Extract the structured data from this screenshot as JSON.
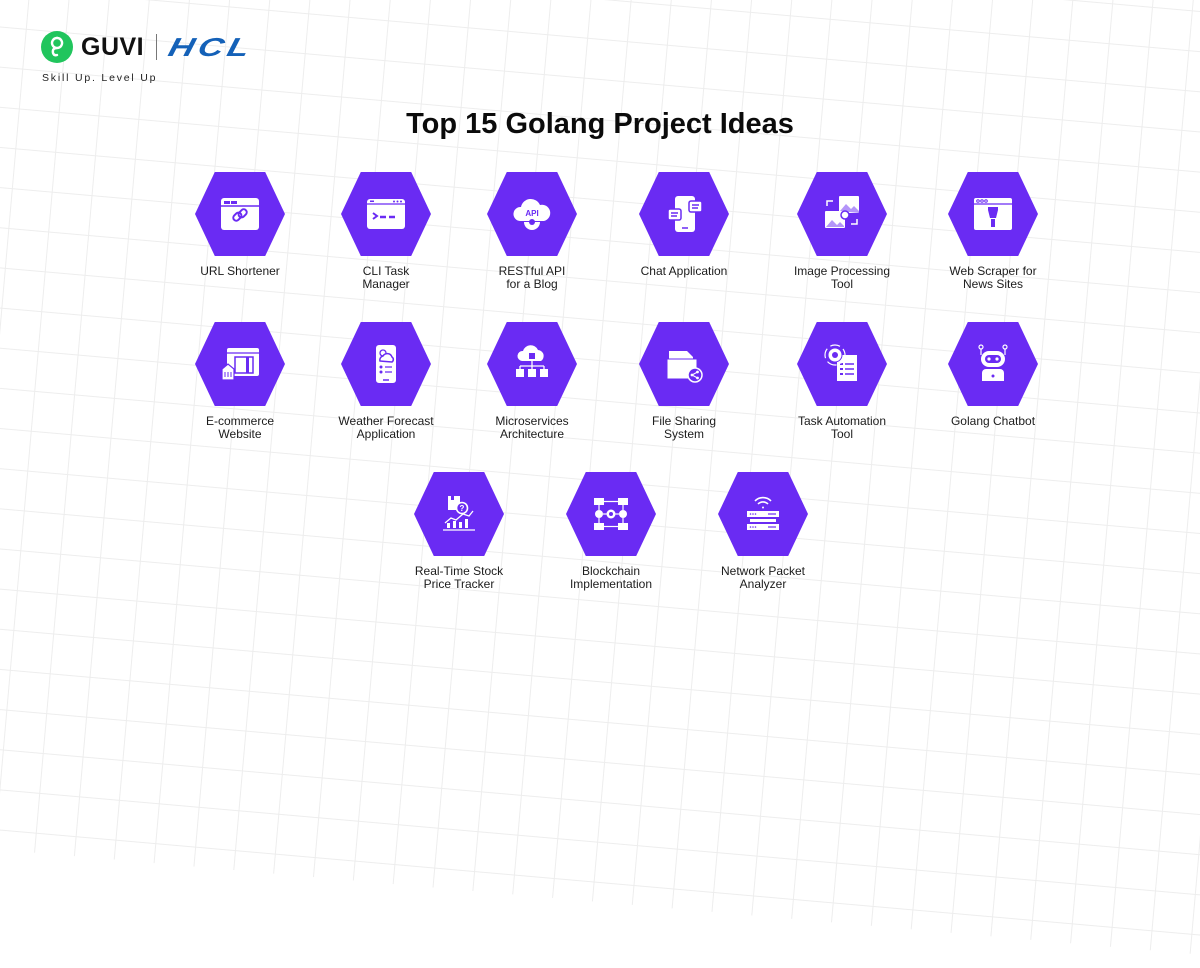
{
  "brand": {
    "guvi": "GUVI",
    "hcl": "HCL",
    "tagline": "Skill Up. Level Up",
    "guvi_color": "#21c55d",
    "hcl_color": "#1461b8"
  },
  "title": "Top 15 Golang Project Ideas",
  "accent_color": "#6a2bf3",
  "items": [
    {
      "label": "URL Shortener",
      "icon": "browser-link-icon"
    },
    {
      "label": "CLI Task\nManager",
      "icon": "terminal-window-icon"
    },
    {
      "label": "RESTful API\nfor a Blog",
      "icon": "api-cloud-gear-icon"
    },
    {
      "label": "Chat Application",
      "icon": "phone-chat-icon"
    },
    {
      "label": "Image Processing\nTool",
      "icon": "image-gear-icon"
    },
    {
      "label": "Web Scraper for\nNews Sites",
      "icon": "browser-scraper-icon"
    },
    {
      "label": "E-commerce\nWebsite",
      "icon": "shop-tag-icon"
    },
    {
      "label": "Weather Forecast\nApplication",
      "icon": "phone-weather-icon"
    },
    {
      "label": "Microservices\nArchitecture",
      "icon": "cloud-cubes-icon"
    },
    {
      "label": "File Sharing\nSystem",
      "icon": "folder-share-icon"
    },
    {
      "label": "Task Automation\nTool",
      "icon": "gear-document-icon"
    },
    {
      "label": "Golang Chatbot",
      "icon": "robot-laptop-icon"
    },
    {
      "label": "Real-Time Stock\nPrice Tracker",
      "icon": "stock-chart-icon"
    },
    {
      "label": "Blockchain\nImplementation",
      "icon": "block-network-icon"
    },
    {
      "label": "Network Packet\nAnalyzer",
      "icon": "wifi-server-icon"
    }
  ]
}
